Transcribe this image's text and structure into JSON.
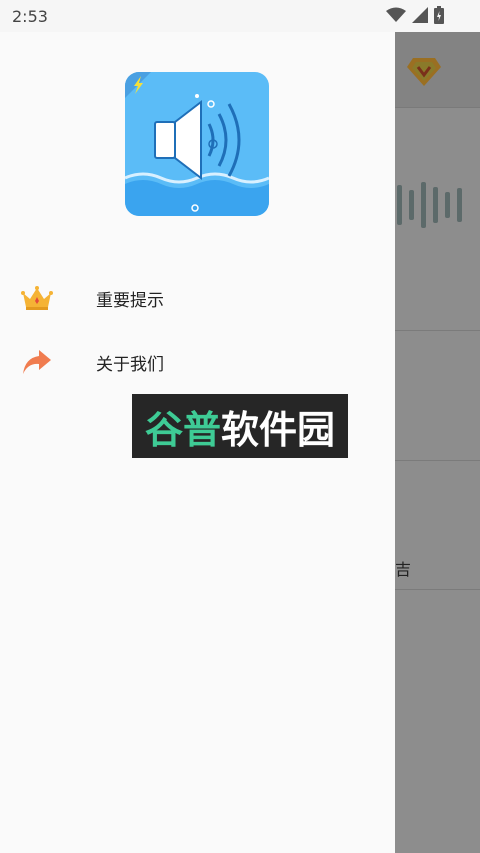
{
  "status_bar": {
    "time": "2:53"
  },
  "background_screen": {
    "partial_texts": [
      "吉"
    ]
  },
  "drawer": {
    "logo_icon": "speaker-volume-icon",
    "menu": [
      {
        "label": "重要提示",
        "icon": "crown-icon"
      },
      {
        "label": "关于我们",
        "icon": "share-arrow-icon"
      }
    ]
  },
  "watermark": {
    "text_green": "谷普",
    "text_white": "软件园"
  },
  "colors": {
    "logo_blue": "#4fb6f7",
    "crown_gold": "#f5b335",
    "arrow_orange": "#f07c4f"
  }
}
